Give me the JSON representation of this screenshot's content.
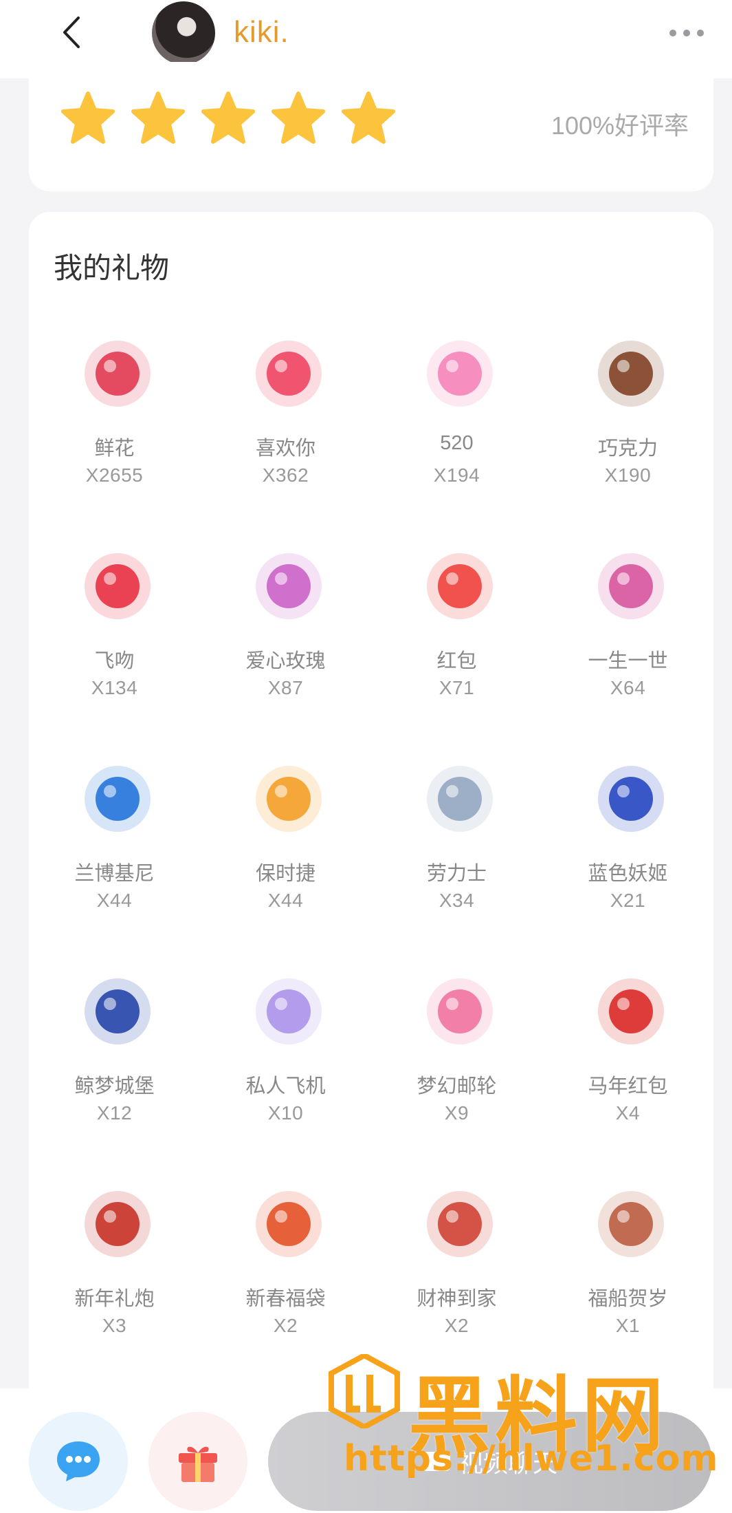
{
  "header": {
    "username": "kiki.",
    "back_icon": "chevron-left-icon",
    "more_icon": "more-dots-icon"
  },
  "rating": {
    "stars": 5,
    "max_stars": 5,
    "star_color": "#fcc33d",
    "rate_text": "100%好评率"
  },
  "gifts": {
    "title": "我的礼物",
    "items": [
      {
        "name": "鲜花",
        "count": "X2655",
        "icon": "rose-icon",
        "color": "#e0314b"
      },
      {
        "name": "喜欢你",
        "count": "X362",
        "icon": "love-text-icon",
        "color": "#ef3c5b"
      },
      {
        "name": "520",
        "count": "X194",
        "icon": "heart-520-icon",
        "color": "#f47fb6"
      },
      {
        "name": "巧克力",
        "count": "X190",
        "icon": "chocolate-icon",
        "color": "#7a3a1c"
      },
      {
        "name": "飞吻",
        "count": "X134",
        "icon": "lips-icon",
        "color": "#e8283b"
      },
      {
        "name": "爱心玫瑰",
        "count": "X87",
        "icon": "heart-roses-icon",
        "color": "#c75cc4"
      },
      {
        "name": "红包",
        "count": "X71",
        "icon": "red-envelope-icon",
        "color": "#ef3a35"
      },
      {
        "name": "一生一世",
        "count": "X64",
        "icon": "1314-icon",
        "color": "#d64f9a"
      },
      {
        "name": "兰博基尼",
        "count": "X44",
        "icon": "lamborghini-icon",
        "color": "#1c6fd8"
      },
      {
        "name": "保时捷",
        "count": "X44",
        "icon": "porsche-icon",
        "color": "#f39a1e"
      },
      {
        "name": "劳力士",
        "count": "X34",
        "icon": "watch-icon",
        "color": "#8fa3bd"
      },
      {
        "name": "蓝色妖姬",
        "count": "X21",
        "icon": "blue-roses-icon",
        "color": "#1e3fc0"
      },
      {
        "name": "鲸梦城堡",
        "count": "X12",
        "icon": "whale-castle-icon",
        "color": "#1c3da6"
      },
      {
        "name": "私人飞机",
        "count": "X10",
        "icon": "jet-icon",
        "color": "#a78ee8"
      },
      {
        "name": "梦幻邮轮",
        "count": "X9",
        "icon": "cruise-ship-icon",
        "color": "#f06d9a"
      },
      {
        "name": "马年红包",
        "count": "X4",
        "icon": "horse-envelope-icon",
        "color": "#d9211f"
      },
      {
        "name": "新年礼炮",
        "count": "X3",
        "icon": "cannon-icon",
        "color": "#c4291f"
      },
      {
        "name": "新春福袋",
        "count": "X2",
        "icon": "lucky-bag-icon",
        "color": "#e24a1f"
      },
      {
        "name": "财神到家",
        "count": "X2",
        "icon": "god-of-wealth-icon",
        "color": "#cf3a2c"
      },
      {
        "name": "福船贺岁",
        "count": "X1",
        "icon": "lucky-boat-icon",
        "color": "#b8573a"
      }
    ]
  },
  "bottom": {
    "chat_icon": "chat-bubble-icon",
    "gift_icon": "gift-box-icon",
    "video_label": "视频聊天",
    "video_icon": "video-camera-icon"
  },
  "watermark": {
    "title": "黑料网",
    "url": "https://hlwe1.com",
    "color": "#f7a21b"
  }
}
